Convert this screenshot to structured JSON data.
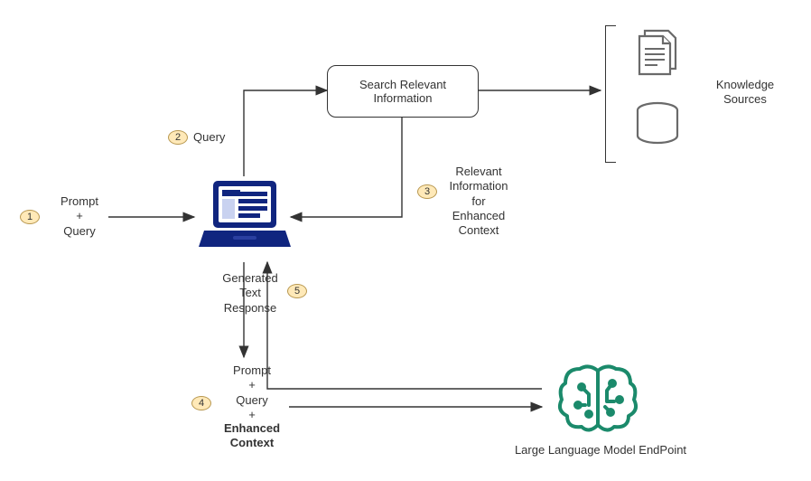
{
  "steps": {
    "s1": "1",
    "s2": "2",
    "s3": "3",
    "s4": "4",
    "s5": "5"
  },
  "labels": {
    "prompt_query": "Prompt\n+\nQuery",
    "query": "Query",
    "search_box": "Search Relevant\nInformation",
    "relevant_info": "Relevant\nInformation\nfor\nEnhanced\nContext",
    "generated": "Generated\nText\nResponse",
    "prompt_query_context_pre": "Prompt\n+\nQuery\n+",
    "enhanced_context": "Enhanced\nContext",
    "knowledge_sources": "Knowledge\nSources",
    "llm_endpoint": "Large Language Model EndPoint"
  },
  "colors": {
    "laptop": "#10257f",
    "brain": "#1b8a6b",
    "step_bg": "#ffe9b8",
    "doc_stroke": "#6a6a6a"
  }
}
